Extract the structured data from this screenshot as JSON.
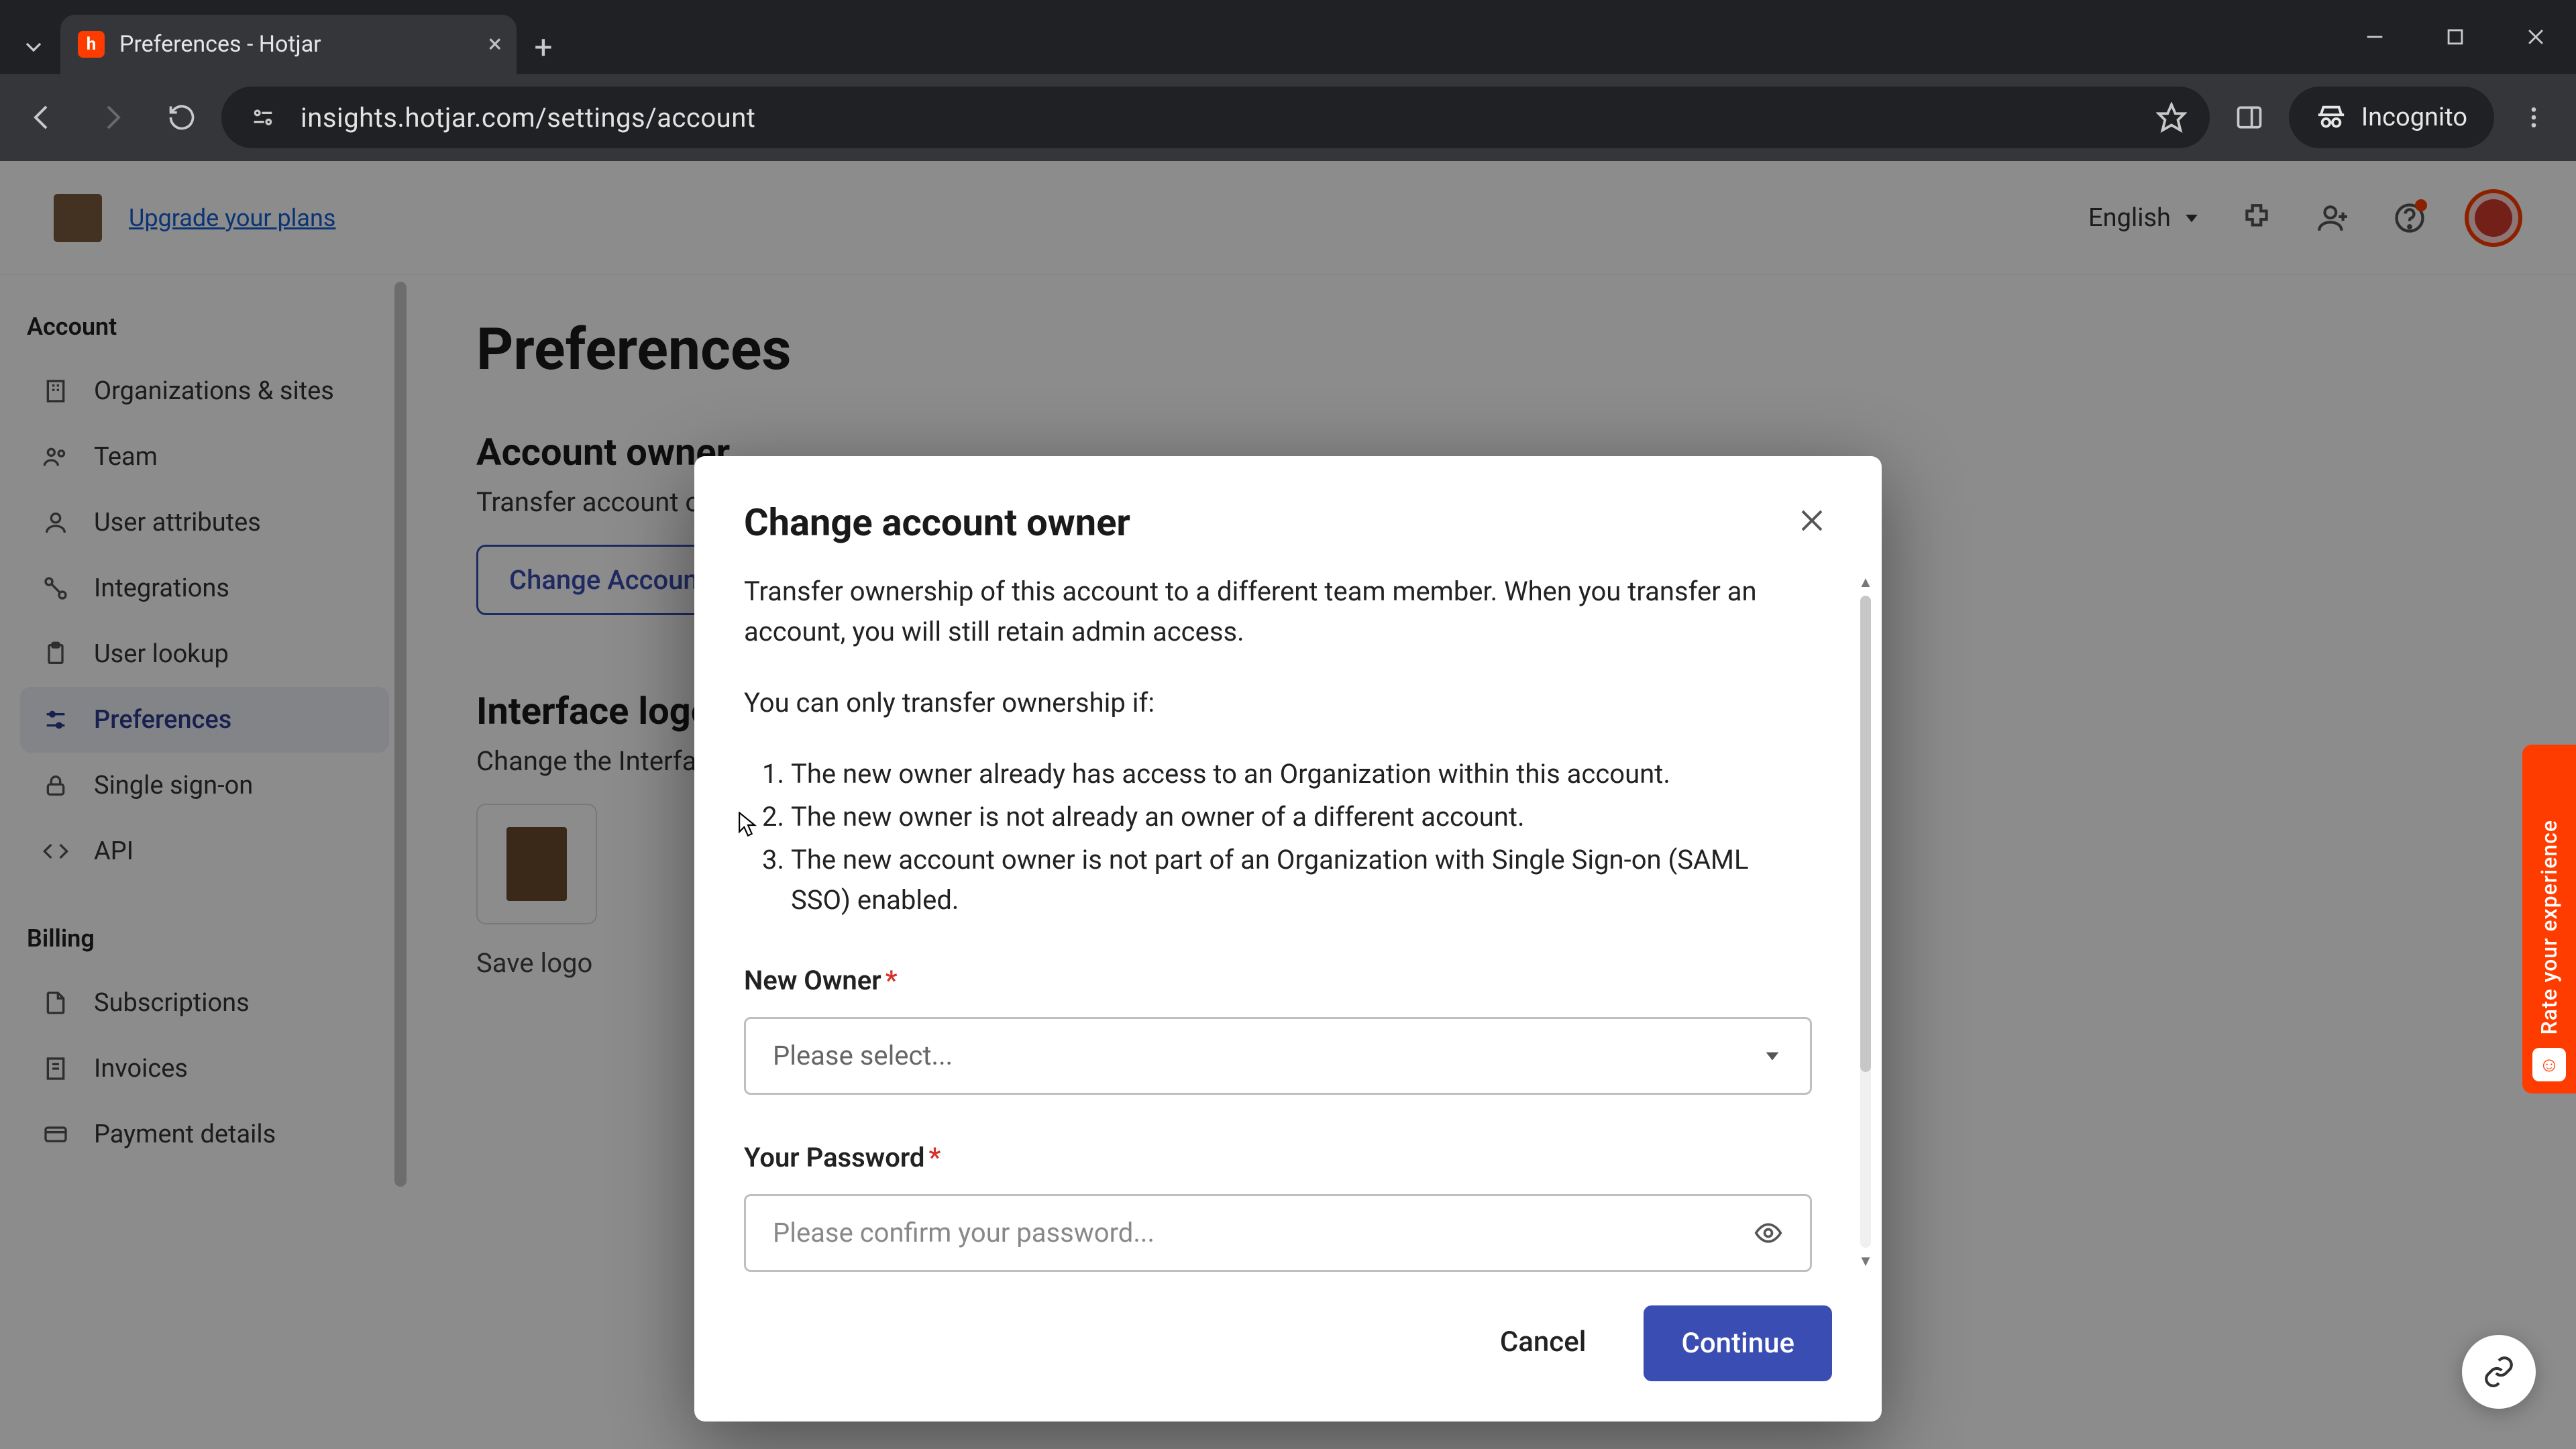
{
  "browser": {
    "tab_title": "Preferences - Hotjar",
    "url": "insights.hotjar.com/settings/account",
    "incognito_label": "Incognito"
  },
  "header": {
    "upgrade_link": "Upgrade your plans",
    "language": "English"
  },
  "sidebar": {
    "group_account": "Account",
    "items_account": [
      "Organizations & sites",
      "Team",
      "User attributes",
      "Integrations",
      "User lookup",
      "Preferences",
      "Single sign-on",
      "API"
    ],
    "group_billing": "Billing",
    "items_billing": [
      "Subscriptions",
      "Invoices",
      "Payment details"
    ]
  },
  "content": {
    "title": "Preferences",
    "section_account_title": "Account owner",
    "section_account_sub": "Transfer account ownership to a different team member.",
    "change_owner_btn": "Change Account Owner",
    "section_interface_title": "Interface logo",
    "section_interface_sub": "Change the Interface logo.",
    "save_logo": "Save logo"
  },
  "feedback": {
    "label": "Rate your experience"
  },
  "modal": {
    "title": "Change account owner",
    "intro": "Transfer ownership of this account to a different team member. When you transfer an account, you will still retain admin access.",
    "cond_lead": "You can only transfer ownership if:",
    "conds": [
      "The new owner already has access to an Organization within this account.",
      "The new owner is not already an owner of a different account.",
      "The new account owner is not part of an Organization with Single Sign-on (SAML SSO) enabled."
    ],
    "new_owner_label": "New Owner",
    "new_owner_placeholder": "Please select...",
    "password_label": "Your Password",
    "password_placeholder": "Please confirm your password...",
    "cancel": "Cancel",
    "continue": "Continue"
  }
}
